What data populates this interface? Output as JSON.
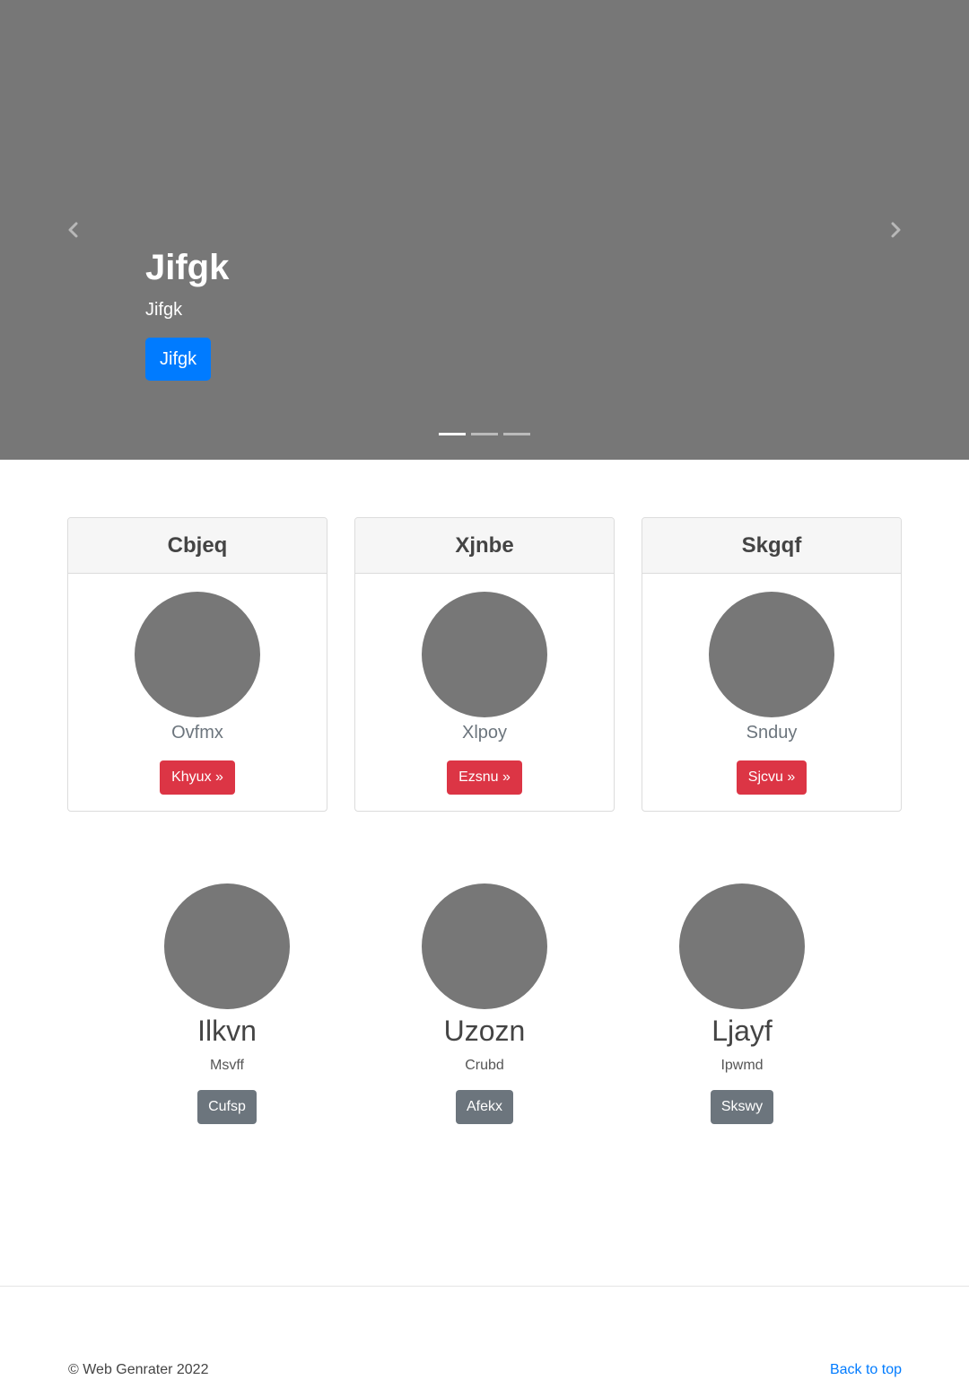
{
  "carousel": {
    "heading": "Jifgk",
    "subheading": "Jifgk",
    "button_label": "Jifgk",
    "indicator_count": 3,
    "active_indicator": 1
  },
  "cards": [
    {
      "header": "Cbjeq",
      "name": "Ovfmx",
      "button": "Khyux »"
    },
    {
      "header": "Xjnbe",
      "name": "Xlpoy",
      "button": "Ezsnu »"
    },
    {
      "header": "Skgqf",
      "name": "Snduy",
      "button": "Sjcvu »"
    }
  ],
  "features": [
    {
      "title": "Ilkvn",
      "subtitle": "Msvff",
      "button": "Cufsp"
    },
    {
      "title": "Uzozn",
      "subtitle": "Crubd",
      "button": "Afekx"
    },
    {
      "title": "Ljayf",
      "subtitle": "Ipwmd",
      "button": "Skswy"
    }
  ],
  "footer": {
    "copyright": "© Web Genrater 2022",
    "back_to_top": "Back to top"
  },
  "colors": {
    "placeholder_gray": "#777777",
    "primary": "#007bff",
    "danger": "#dc3545",
    "secondary": "#6c757d"
  }
}
